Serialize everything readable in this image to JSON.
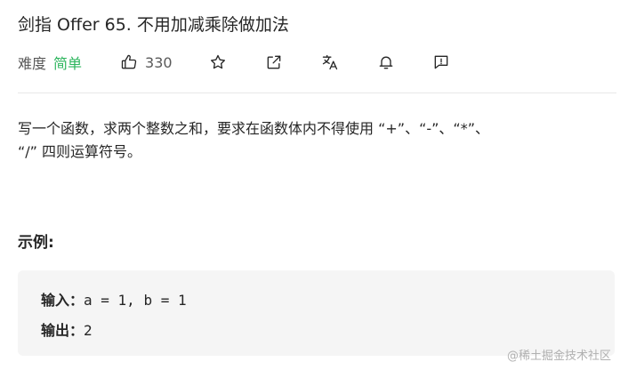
{
  "problem": {
    "title": "剑指 Offer 65. 不用加减乘除做加法",
    "difficulty_label": "难度",
    "difficulty": "简单",
    "likes": "330"
  },
  "icons": [
    "thumbs-up-icon",
    "star-icon",
    "share-icon",
    "translate-icon",
    "bell-icon",
    "feedback-icon"
  ],
  "colors": {
    "difficulty_easy": "#2db55d",
    "text": "#262626",
    "muted": "#595959"
  },
  "description": {
    "line1": "写一个函数，求两个整数之和，要求在函数体内不得使用 “+”、“-”、“*”、",
    "line2": "“/” 四则运算符号。"
  },
  "example": {
    "heading": "示例:",
    "input_label": "输入：",
    "input_value": "a = 1, b = 1",
    "output_label": "输出：",
    "output_value": "2"
  },
  "watermark": "@稀土掘金技术社区"
}
